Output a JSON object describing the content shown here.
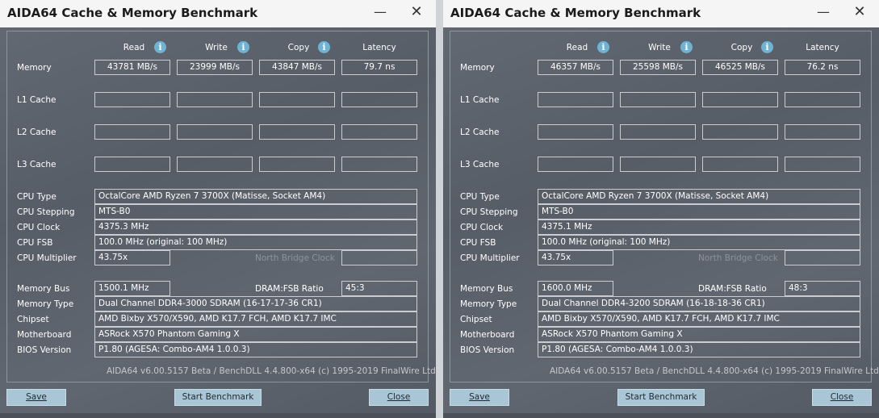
{
  "windows": [
    {
      "title": "AIDA64 Cache & Memory Benchmark",
      "minimize_glyph": "—",
      "close_glyph": "✕",
      "col_headers": {
        "read": "Read",
        "write": "Write",
        "copy": "Copy",
        "latency": "Latency"
      },
      "info_glyph": "i",
      "rows": {
        "memory": {
          "label": "Memory",
          "read": "43781 MB/s",
          "write": "23999 MB/s",
          "copy": "43847 MB/s",
          "latency": "79.7 ns"
        },
        "l1": {
          "label": "L1 Cache"
        },
        "l2": {
          "label": "L2 Cache"
        },
        "l3": {
          "label": "L3 Cache"
        }
      },
      "cpu": {
        "type_label": "CPU Type",
        "type": "OctalCore AMD Ryzen 7 3700X  (Matisse, Socket AM4)",
        "stepping_label": "CPU Stepping",
        "stepping": "MTS-B0",
        "clock_label": "CPU Clock",
        "clock": "4375.3 MHz",
        "fsb_label": "CPU FSB",
        "fsb": "100.0 MHz  (original: 100 MHz)",
        "mult_label": "CPU Multiplier",
        "mult": "43.75x",
        "nb_label": "North Bridge Clock"
      },
      "mem": {
        "bus_label": "Memory Bus",
        "bus": "1500.1 MHz",
        "ratio_label": "DRAM:FSB Ratio",
        "ratio": "45:3",
        "type_label": "Memory Type",
        "type": "Dual Channel DDR4-3000 SDRAM  (16-17-17-36 CR1)",
        "chipset_label": "Chipset",
        "chipset": "AMD Bixby X570/X590, AMD K17.7 FCH, AMD K17.7 IMC",
        "mb_label": "Motherboard",
        "mb": "ASRock X570 Phantom Gaming X",
        "bios_label": "BIOS Version",
        "bios": "P1.80  (AGESA: Combo-AM4 1.0.0.3)"
      },
      "footer": "AIDA64 v6.00.5157 Beta / BenchDLL 4.4.800-x64  (c) 1995-2019 FinalWire Ltd.",
      "buttons": {
        "save": "Save",
        "start": "Start Benchmark",
        "close": "Close"
      }
    },
    {
      "title": "AIDA64 Cache & Memory Benchmark",
      "minimize_glyph": "—",
      "close_glyph": "✕",
      "col_headers": {
        "read": "Read",
        "write": "Write",
        "copy": "Copy",
        "latency": "Latency"
      },
      "info_glyph": "i",
      "rows": {
        "memory": {
          "label": "Memory",
          "read": "46357 MB/s",
          "write": "25598 MB/s",
          "copy": "46525 MB/s",
          "latency": "76.2 ns"
        },
        "l1": {
          "label": "L1 Cache"
        },
        "l2": {
          "label": "L2 Cache"
        },
        "l3": {
          "label": "L3 Cache"
        }
      },
      "cpu": {
        "type_label": "CPU Type",
        "type": "OctalCore AMD Ryzen 7 3700X  (Matisse, Socket AM4)",
        "stepping_label": "CPU Stepping",
        "stepping": "MTS-B0",
        "clock_label": "CPU Clock",
        "clock": "4375.1 MHz",
        "fsb_label": "CPU FSB",
        "fsb": "100.0 MHz  (original: 100 MHz)",
        "mult_label": "CPU Multiplier",
        "mult": "43.75x",
        "nb_label": "North Bridge Clock"
      },
      "mem": {
        "bus_label": "Memory Bus",
        "bus": "1600.0 MHz",
        "ratio_label": "DRAM:FSB Ratio",
        "ratio": "48:3",
        "type_label": "Memory Type",
        "type": "Dual Channel DDR4-3200 SDRAM  (16-18-18-36 CR1)",
        "chipset_label": "Chipset",
        "chipset": "AMD Bixby X570/X590, AMD K17.7 FCH, AMD K17.7 IMC",
        "mb_label": "Motherboard",
        "mb": "ASRock X570 Phantom Gaming X",
        "bios_label": "BIOS Version",
        "bios": "P1.80  (AGESA: Combo-AM4 1.0.0.3)"
      },
      "footer": "AIDA64 v6.00.5157 Beta / BenchDLL 4.4.800-x64  (c) 1995-2019 FinalWire Ltd.",
      "buttons": {
        "save": "Save",
        "start": "Start Benchmark",
        "close": "Close"
      }
    }
  ],
  "colors": {
    "info_icon": "#6fb3d3",
    "button_bg": "#a9c6d6",
    "window_bg": "#5b616b"
  }
}
